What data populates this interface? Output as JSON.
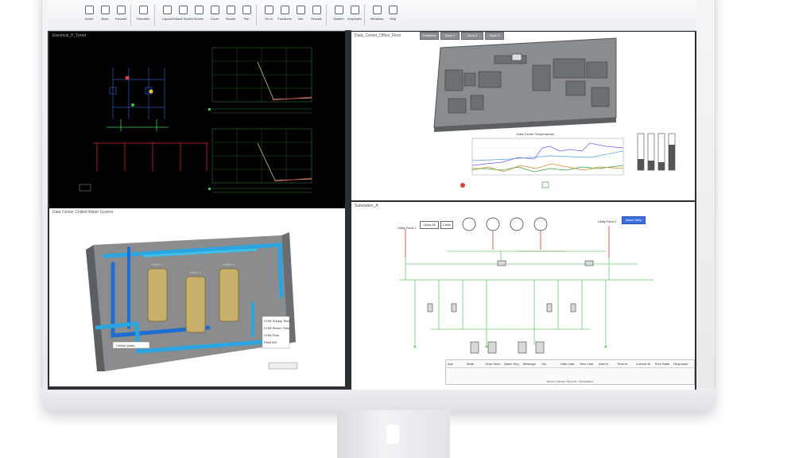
{
  "toolbar": {
    "buttons": [
      {
        "icon": "home-icon",
        "label": "Home"
      },
      {
        "icon": "back-icon",
        "label": "Back"
      },
      {
        "icon": "forward-icon",
        "label": "Forward"
      },
      {
        "icon": "favorites-icon",
        "label": "Favorites"
      },
      {
        "icon": "layout-icon",
        "label": "Layout"
      },
      {
        "icon": "default-screen-icon",
        "label": "Default Screen"
      },
      {
        "icon": "screen-icon",
        "label": "Screen"
      },
      {
        "icon": "zoom-icon",
        "label": "Zoom"
      },
      {
        "icon": "visuals-icon",
        "label": "Visuals"
      },
      {
        "icon": "pan-icon",
        "label": "Pan"
      },
      {
        "icon": "go-to-icon",
        "label": "Go to"
      },
      {
        "icon": "functions-icon",
        "label": "Functions"
      },
      {
        "icon": "info-icon",
        "label": "Info"
      },
      {
        "icon": "results-icon",
        "label": "Results"
      },
      {
        "icon": "system-icon",
        "label": "System"
      },
      {
        "icon": "examples-icon",
        "label": "Examples"
      },
      {
        "icon": "windows-icon",
        "label": "Windows"
      },
      {
        "icon": "help-icon",
        "label": "Help"
      }
    ]
  },
  "panes": {
    "electrical_tr": {
      "title": "Electrical_P_Trend"
    },
    "floor_plan": {
      "title": "Data_Center_Office_Floor",
      "tabs": [
        "Overview",
        "Zone 1",
        "Zone 2",
        "Zone 3"
      ],
      "chart_title": "Data Center Temperatures"
    },
    "cooling": {
      "title": "Data Center Chilled Water System",
      "labels": [
        "Chiller 1",
        "Chiller 2",
        "Chiller 3"
      ],
      "overlay_btn": "Chilled Water",
      "info_panel": [
        "CHW Supply Temp",
        "CHW Return Temp",
        "CHW Flow",
        "Plant kW"
      ]
    },
    "single_line": {
      "title": "Substation_A",
      "utility_left": "Utility Feed 1",
      "utility_right": "Utility Feed 2",
      "btn_left1": "Open All",
      "btn_left2": "Close",
      "btn_right": "Alarm View",
      "table_columns": [
        "Ack",
        "State",
        "Time Seen",
        "Alarm Seq",
        "Message",
        "Cls",
        "Date Last",
        "Time Last",
        "Date In",
        "Time In",
        "Current St",
        "Prev State",
        "Response"
      ],
      "table_footer": "Alarm Viewer Source: Substation"
    }
  }
}
